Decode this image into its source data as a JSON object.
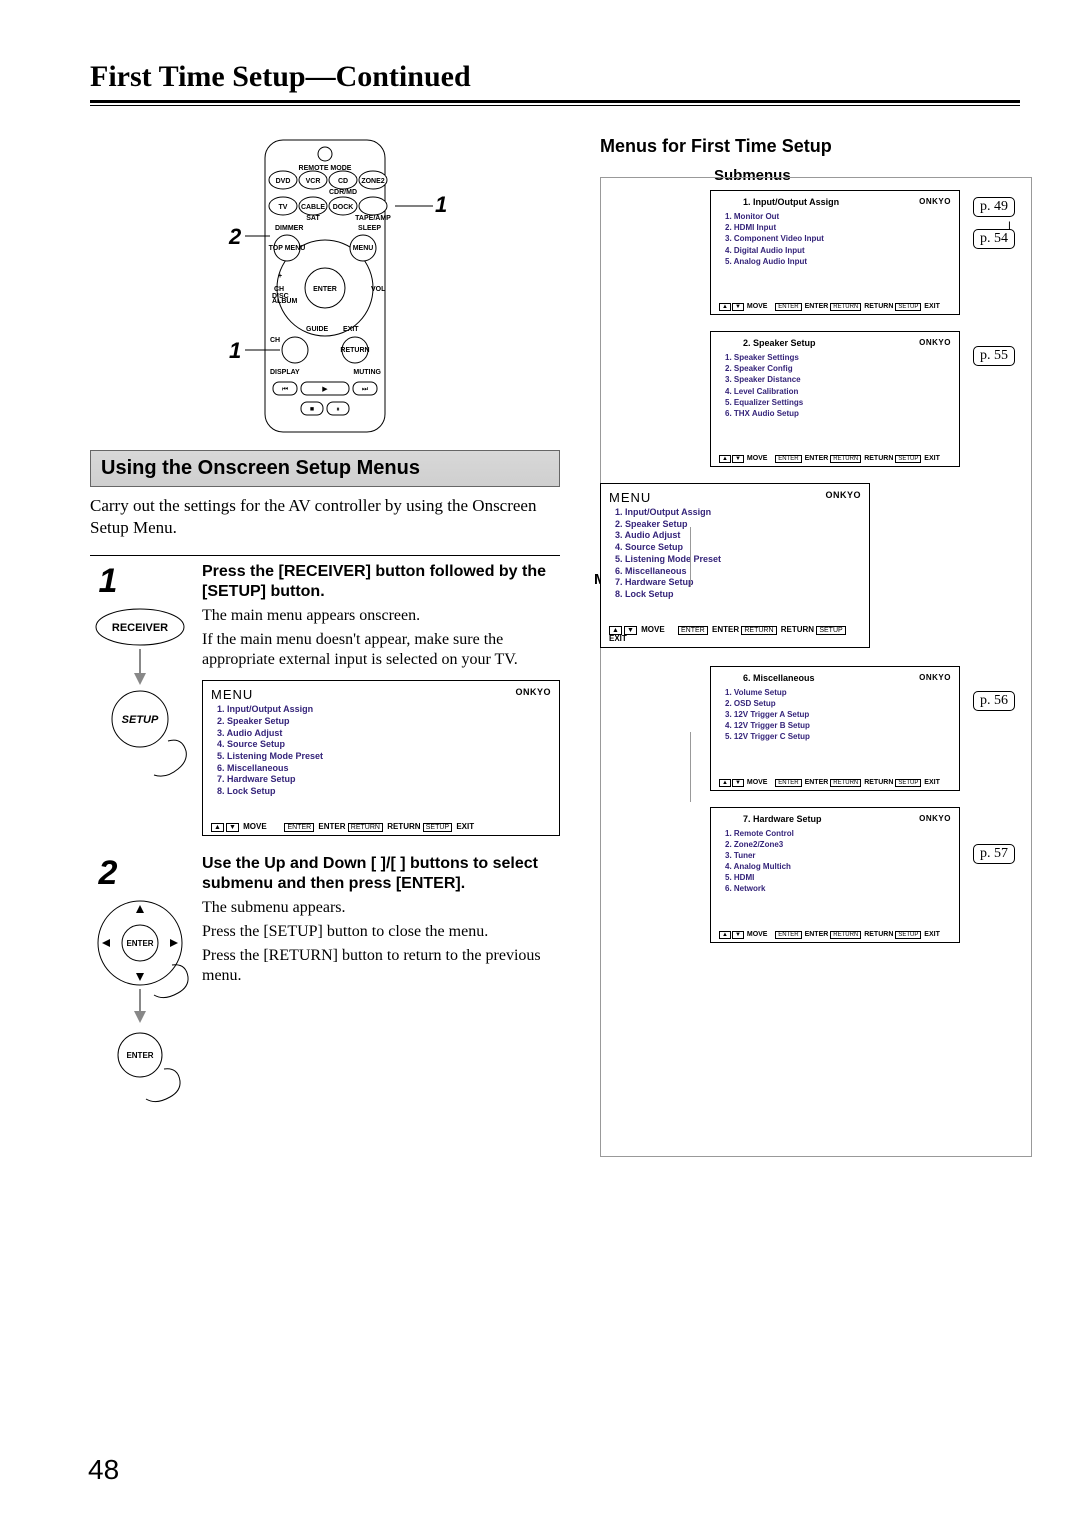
{
  "page_heading": {
    "main": "First Time Setup",
    "sep": "—",
    "cont": "Continued"
  },
  "left": {
    "section_title": "Using the Onscreen Setup Menus",
    "intro": "Carry out the settings for the AV controller by using the Onscreen Setup Menu.",
    "step1": {
      "head": "Press the [RECEIVER] button followed by the [SETUP] button.",
      "p1": "The main menu appears onscreen.",
      "p2": "If the main menu doesn't appear, make sure the appropriate external input is selected on your TV.",
      "receiver_label": "RECEIVER",
      "setup_label": "SETUP"
    },
    "step2": {
      "head": "Use the Up and Down [ ]/[ ] buttons to select submenu and then press [ENTER].",
      "p1": "The submenu appears.",
      "p2": "Press the [SETUP] button to close the menu.",
      "p3": "Press the [RETURN] button to return to the previous menu.",
      "enter_label": "ENTER"
    },
    "osd": {
      "brand": "ONKYO",
      "title": "MENU",
      "items": [
        "1. Input/Output Assign",
        "2. Speaker Setup",
        "3. Audio Adjust",
        "4. Source Setup",
        "5. Listening Mode Preset",
        "6. Miscellaneous",
        "7. Hardware Setup",
        "8. Lock Setup"
      ],
      "footer_move": "MOVE",
      "footer_enter": "ENTER",
      "footer_return": "RETURN",
      "footer_exit": "EXIT"
    }
  },
  "right": {
    "heading": "Menus for First Time Setup",
    "submenus_label": "Submenus",
    "mainmenu_label": "Main menu",
    "brand": "ONKYO",
    "panels": {
      "io": {
        "title": "1.   Input/Output Assign",
        "items": [
          "1.   Monitor Out",
          "2.   HDMI Input",
          "3.   Component Video Input",
          "4.   Digital Audio Input",
          "5.   Analog Audio Input"
        ],
        "refs": [
          "p. 49",
          "p. 54"
        ]
      },
      "speaker": {
        "title": "2.   Speaker Setup",
        "items": [
          "1.   Speaker Settings",
          "2.   Speaker Config",
          "3.   Speaker Distance",
          "4.   Level Calibration",
          "5.   Equalizer Settings",
          "6.   THX Audio Setup"
        ],
        "refs": [
          "p. 55"
        ]
      },
      "misc": {
        "title": "6.   Miscellaneous",
        "items": [
          "1.   Volume Setup",
          "2.   OSD Setup",
          "3.   12V Trigger A Setup",
          "4.   12V Trigger B Setup",
          "5.   12V Trigger C Setup"
        ],
        "refs": [
          "p. 56"
        ]
      },
      "hw": {
        "title": "7.   Hardware Setup",
        "items": [
          "1.   Remote Control",
          "2.   Zone2/Zone3",
          "3.   Tuner",
          "4.   Analog Multich",
          "5.   HDMI",
          "6.   Network"
        ],
        "refs": [
          "p. 57"
        ]
      },
      "main": {
        "title": "MENU",
        "items": [
          "1. Input/Output Assign",
          "2. Speaker Setup",
          "3. Audio Adjust",
          "4. Source Setup",
          "5. Listening Mode Preset",
          "6. Miscellaneous",
          "7. Hardware Setup",
          "8. Lock Setup"
        ]
      }
    },
    "footer": {
      "move": "MOVE",
      "enter": "ENTER",
      "return": "RETURN",
      "exit": "EXIT"
    }
  },
  "remote": {
    "labels": {
      "remote_mode": "REMOTE MODE",
      "dvd": "DVD",
      "vcr": "VCR",
      "cd": "CD",
      "zone2": "ZONE2",
      "tv": "TV",
      "cable": "CABLE",
      "dock": "DOCK",
      "rcvr": "RCVR / TAPE/AMP",
      "sat": "SAT",
      "cdrmd": "CDR/MD",
      "dimmer": "DIMMER",
      "sleep": "SLEEP",
      "topmenu": "TOP MENU",
      "menu": "MENU",
      "ch": "CH",
      "disc": "DISC",
      "album": "ALBUM",
      "vol": "VOL",
      "guide": "GUIDE",
      "exit": "EXIT",
      "setup": "SETUP",
      "return": "RETURN",
      "display": "DISPLAY",
      "muting": "MUTING",
      "enter": "ENTER"
    }
  },
  "page_number": "48"
}
